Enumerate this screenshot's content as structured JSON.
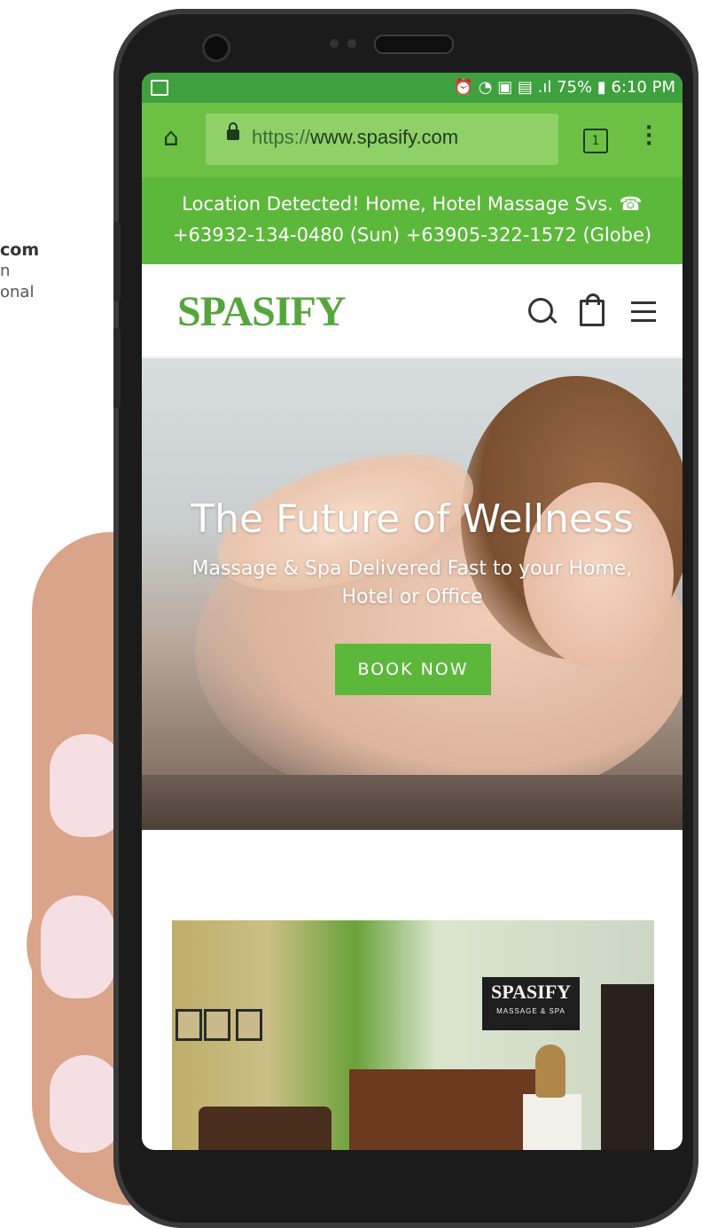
{
  "side_caption": {
    "line1": "com",
    "line2": "n",
    "line3": "onal"
  },
  "status_bar": {
    "right": "⏰ ◔ ▣ ▤ .ıl 75% ▮ 6:10 PM"
  },
  "browser": {
    "url_scheme": "https://",
    "url_host": "www.spasify.com",
    "tab_count": "1"
  },
  "banner": {
    "line1": "Location Detected! Home, Hotel Massage Svs. ☎",
    "line2": "+63932-134-0480 (Sun) +63905-322-1572 (Globe)"
  },
  "header": {
    "logo": "SPASIFY"
  },
  "hero": {
    "title": "The Future of Wellness",
    "subtitle_line1": "Massage & Spa Delivered Fast to your Home,",
    "subtitle_line2": "Hotel or Office",
    "cta": "BOOK NOW"
  },
  "store_sign": {
    "name": "SPASIFY",
    "tagline": "MASSAGE & SPA"
  },
  "colors": {
    "accent_green": "#5cb83a",
    "url_bar": "#6cc144",
    "status_bar": "#3fa03f"
  }
}
